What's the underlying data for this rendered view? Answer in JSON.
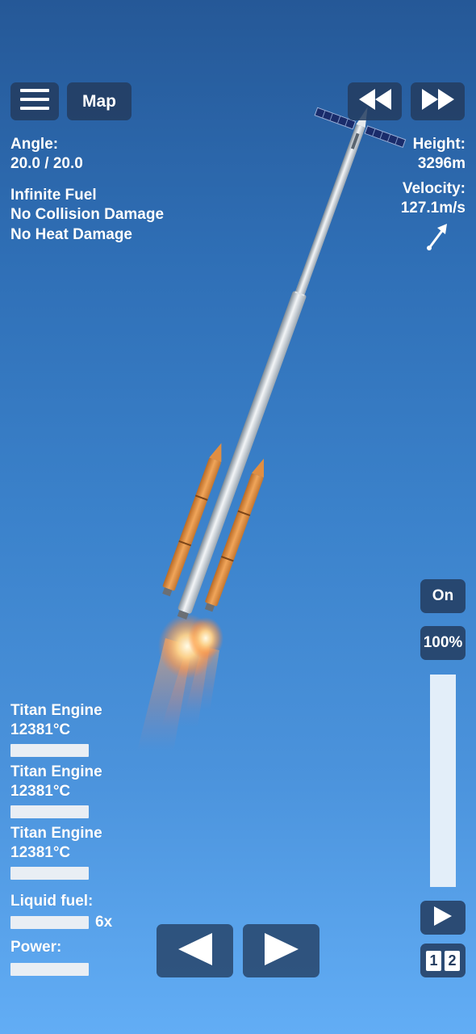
{
  "top_bar": {
    "menu_icon": "hamburger-menu-icon",
    "map_label": "Map",
    "rewind_icon": "rewind-icon",
    "fast_forward_icon": "fast-forward-icon"
  },
  "flight_info": {
    "angle_label": "Angle:",
    "angle_value": "20.0 / 20.0",
    "cheats": [
      "Infinite Fuel",
      "No Collision Damage",
      "No Heat Damage"
    ],
    "height_label": "Height:",
    "height_value": "3296m",
    "velocity_label": "Velocity:",
    "velocity_value": "127.1m/s",
    "velocity_arrow_icon": "velocity-direction-arrow-icon"
  },
  "engines": [
    {
      "name": "Titan Engine",
      "temp": "12381°C",
      "bar_fill": 1.0
    },
    {
      "name": "Titan Engine",
      "temp": "12381°C",
      "bar_fill": 1.0
    },
    {
      "name": "Titan Engine",
      "temp": "12381°C",
      "bar_fill": 1.0
    }
  ],
  "resources": {
    "fuel_label": "Liquid fuel:",
    "fuel_multiplier": "6x",
    "fuel_fill": 1.0,
    "power_label": "Power:",
    "power_fill": 1.0
  },
  "controls": {
    "engine_toggle_label": "On",
    "throttle_label": "100%",
    "throttle_fill": 1.0,
    "play_icon": "play-icon",
    "stage_numbers": [
      "1",
      "2"
    ],
    "rotate_left_icon": "rotate-left-arrow-icon",
    "rotate_right_icon": "rotate-right-arrow-icon"
  },
  "colors": {
    "sky_top": "#255897",
    "sky_bottom": "#62adf5",
    "button_bg": "#233c5f",
    "bar_color": "#e9eef4",
    "booster_orange": "#d98a3c"
  }
}
